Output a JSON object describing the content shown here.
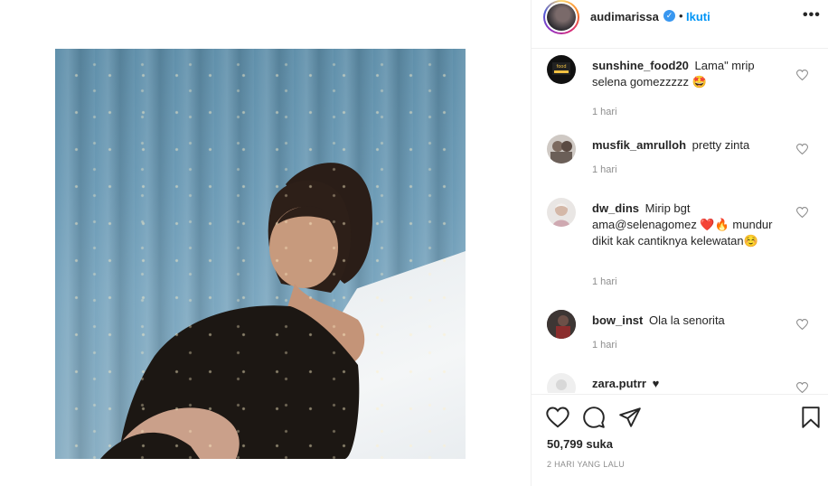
{
  "post": {
    "username": "audimarissa",
    "verified_icon": "verified-badge-icon",
    "separator": "•",
    "follow_label": "Ikuti",
    "more_icon": "more-options-icon",
    "more_label": "•••"
  },
  "comments": [
    {
      "username": "sunshine_food20",
      "text": "Lama\" mrip selena gomezzzzz 🤩",
      "time": "1 hari"
    },
    {
      "username": "musfik_amrulloh",
      "text": "pretty zinta",
      "time": "1 hari"
    },
    {
      "username": "dw_dins",
      "text": "Mirip bgt ama@selenagomez ❤️🔥 mundur dikit kak cantiknya kelewatan☺️",
      "time": "1 hari"
    },
    {
      "username": "bow_inst",
      "text": "Ola la senorita",
      "time": "1 hari"
    },
    {
      "username": "zara.putrr",
      "text": "♥",
      "time": ""
    }
  ],
  "actions": {
    "like_icon": "heart-icon",
    "comment_icon": "comment-bubble-icon",
    "share_icon": "paper-plane-icon",
    "save_icon": "bookmark-icon"
  },
  "likes_text": "50,799 suka",
  "date_text": "2 HARI YANG LALU",
  "colors": {
    "link_blue": "#0095f6",
    "verified_blue": "#3897f0",
    "text_dark": "#262626",
    "text_gray": "#8e8e8e",
    "divider": "#efefef"
  }
}
